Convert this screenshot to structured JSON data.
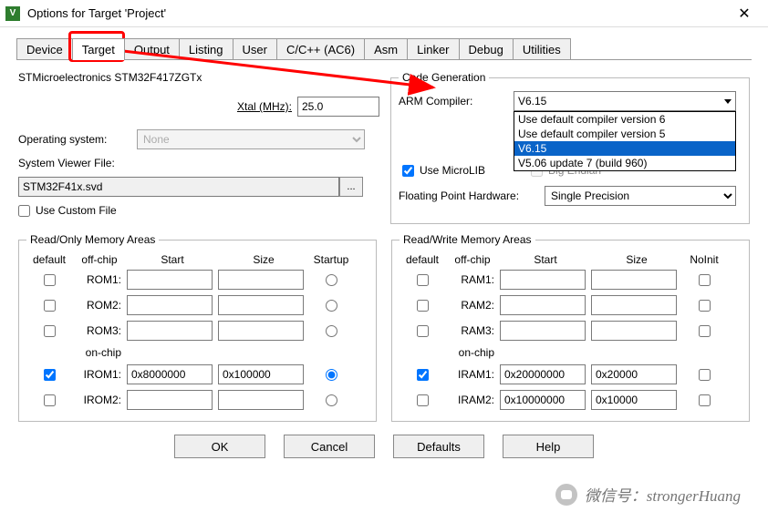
{
  "window": {
    "title": "Options for Target 'Project'"
  },
  "tabs": [
    "Device",
    "Target",
    "Output",
    "Listing",
    "User",
    "C/C++ (AC6)",
    "Asm",
    "Linker",
    "Debug",
    "Utilities"
  ],
  "active_tab": "Target",
  "device": "STMicroelectronics STM32F417ZGTx",
  "xtal_label": "Xtal (MHz):",
  "xtal_value": "25.0",
  "os_label": "Operating system:",
  "os_value": "None",
  "svf_label": "System Viewer File:",
  "svf_value": "STM32F41x.svd",
  "use_custom_file": "Use Custom File",
  "codegen": {
    "legend": "Code Generation",
    "arm_compiler_label": "ARM Compiler:",
    "arm_compiler_value": "V6.15",
    "options": [
      "Use default compiler version 6",
      "Use default compiler version 5",
      "V6.15",
      "V5.06 update 7 (build 960)"
    ],
    "use_microlib": "Use MicroLIB",
    "big_endian": "Big Endian",
    "fph_label": "Floating Point Hardware:",
    "fph_value": "Single Precision"
  },
  "ro": {
    "legend": "Read/Only Memory Areas",
    "cols": [
      "default",
      "off-chip",
      "Start",
      "Size",
      "Startup"
    ],
    "onchip": "on-chip",
    "rows": [
      {
        "name": "ROM1:",
        "default": false,
        "start": "",
        "size": "",
        "startup": false
      },
      {
        "name": "ROM2:",
        "default": false,
        "start": "",
        "size": "",
        "startup": false
      },
      {
        "name": "ROM3:",
        "default": false,
        "start": "",
        "size": "",
        "startup": false
      }
    ],
    "rows2": [
      {
        "name": "IROM1:",
        "default": true,
        "start": "0x8000000",
        "size": "0x100000",
        "startup": true
      },
      {
        "name": "IROM2:",
        "default": false,
        "start": "",
        "size": "",
        "startup": false
      }
    ]
  },
  "rw": {
    "legend": "Read/Write Memory Areas",
    "cols": [
      "default",
      "off-chip",
      "Start",
      "Size",
      "NoInit"
    ],
    "onchip": "on-chip",
    "rows": [
      {
        "name": "RAM1:",
        "default": false,
        "start": "",
        "size": "",
        "noinit": false
      },
      {
        "name": "RAM2:",
        "default": false,
        "start": "",
        "size": "",
        "noinit": false
      },
      {
        "name": "RAM3:",
        "default": false,
        "start": "",
        "size": "",
        "noinit": false
      }
    ],
    "rows2": [
      {
        "name": "IRAM1:",
        "default": true,
        "start": "0x20000000",
        "size": "0x20000",
        "noinit": false
      },
      {
        "name": "IRAM2:",
        "default": false,
        "start": "0x10000000",
        "size": "0x10000",
        "noinit": false
      }
    ]
  },
  "buttons": {
    "ok": "OK",
    "cancel": "Cancel",
    "defaults": "Defaults",
    "help": "Help"
  },
  "watermark": "微信号：strongerHuang"
}
